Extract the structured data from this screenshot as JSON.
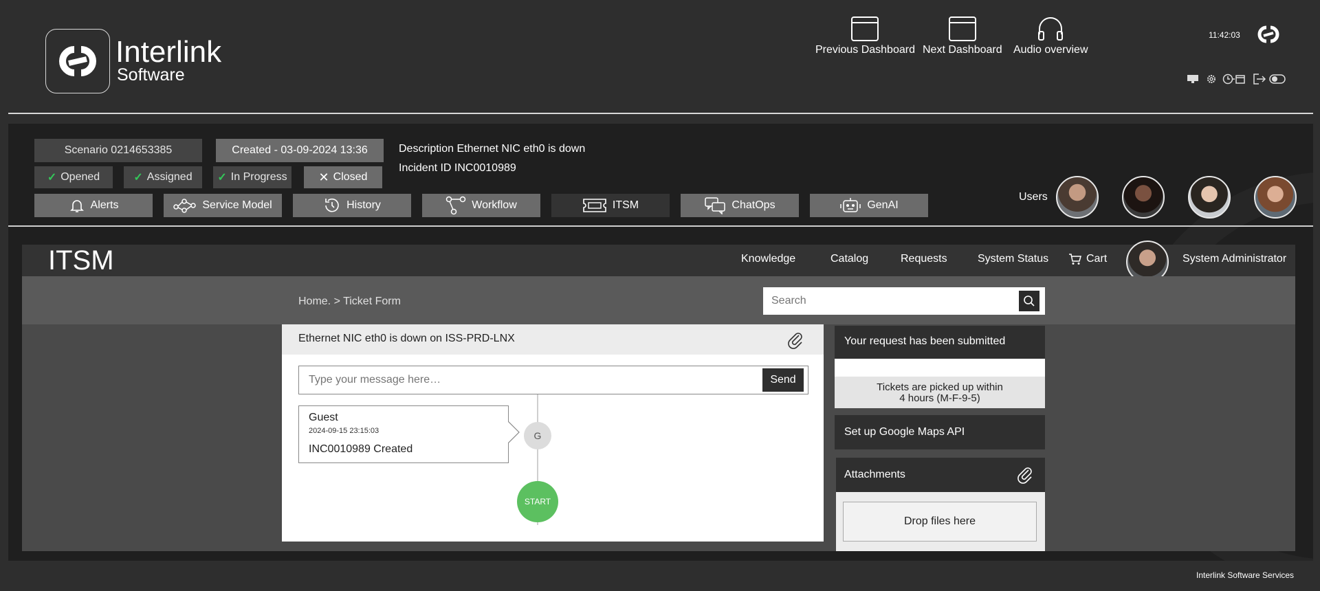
{
  "brand": {
    "name": "Interlink",
    "sub": "Software"
  },
  "header": {
    "nav": [
      {
        "label": "Previous Dashboard",
        "icon": "window-icon"
      },
      {
        "label": "Next Dashboard",
        "icon": "window-icon"
      },
      {
        "label": "Audio overview",
        "icon": "headphones-icon"
      }
    ],
    "time": "11:42:03",
    "toolbar_icons": [
      "monitor-icon",
      "gear-icon",
      "clock-calendar-icon",
      "logout-icon",
      "toggle-icon"
    ]
  },
  "incident": {
    "scenario": "Scenario 0214653385",
    "created": "Created - 03-09-2024 13:36",
    "description": "Description Ethernet NIC eth0 is down",
    "incident_id": "Incident ID INC0010989",
    "statuses": [
      {
        "label": "Opened",
        "state": "done"
      },
      {
        "label": "Assigned",
        "state": "done"
      },
      {
        "label": "In Progress",
        "state": "done"
      },
      {
        "label": "Closed",
        "state": "closed"
      }
    ],
    "tabs": [
      {
        "label": "Alerts",
        "icon": "bell-icon"
      },
      {
        "label": "Service Model",
        "icon": "nodes-icon"
      },
      {
        "label": "History",
        "icon": "history-icon"
      },
      {
        "label": "Workflow",
        "icon": "workflow-icon"
      },
      {
        "label": "ITSM",
        "icon": "ticket-icon",
        "active": true
      },
      {
        "label": "ChatOps",
        "icon": "chat-icon"
      },
      {
        "label": "GenAI",
        "icon": "robot-icon"
      }
    ],
    "users_label": "Users"
  },
  "itsm": {
    "title": "ITSM",
    "menu": [
      "Knowledge",
      "Catalog",
      "Requests",
      "System Status",
      "Cart"
    ],
    "user": "System Administrator",
    "breadcrumb": "Home. > Ticket Form",
    "search_placeholder": "Search",
    "ticket_title": "Ethernet NIC eth0 is down on ISS-PRD-LNX",
    "message_placeholder": "Type your message here…",
    "send": "Send",
    "entry": {
      "author": "Guest",
      "date": "2024-09-15 23:15:03",
      "text": "INC0010989 Created",
      "initial": "G"
    },
    "start": "START",
    "side": {
      "submitted": "Your request has been submitted",
      "pickup_line1": "Tickets are picked up within",
      "pickup_line2": "4 hours (M-F-9-5)",
      "maps": "Set up Google Maps API",
      "attachments": "Attachments",
      "drop": "Drop files here"
    }
  },
  "footer": "Interlink Software Services",
  "colors": {
    "bg": "#2e2e2e",
    "panel": "#1f1f1f",
    "accent_green": "#5cc060",
    "check": "#34c759"
  }
}
